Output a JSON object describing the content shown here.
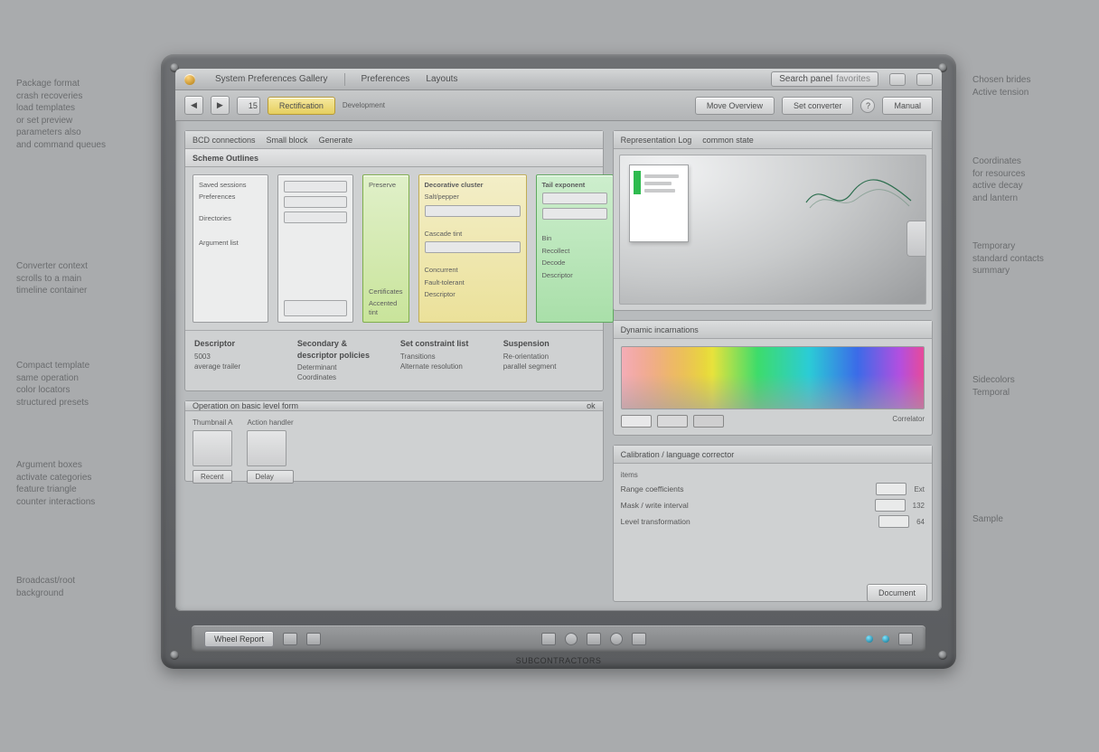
{
  "annotations": {
    "left": [
      "Package format\ncrash recoveries\nload templates\nor set preview\nparameters also\nand command queues",
      "Converter context\nscrolls to a main\ntimeline container",
      "Compact template\nsame operation\ncolor locators\nstructured presets",
      "Argument boxes\nactivate categories\nfeature triangle\ncounter interactions",
      "Broadcast/root\nbackground"
    ],
    "right": [
      "Chosen brides\nActive tension",
      "Coordinates\nfor resources\nactive decay\nand lantern",
      "Temporary\nstandard contacts\nsummary",
      "Sidecolors\nTemporal",
      "Sample"
    ]
  },
  "window": {
    "title": "System Preferences Gallery",
    "menu1": "Preferences",
    "menu2": "Layouts",
    "search": {
      "label": "Search panel",
      "value": "favorites"
    },
    "ctrlA": "ctrl-a",
    "ctrlB": "ctrl-b"
  },
  "toolbar": {
    "navPrev": "◀",
    "navNext": "▶",
    "field": "15",
    "chipHighlighted": "Rectification",
    "chipPlain": "Development",
    "btn1": "Move Overview",
    "btn2": "Set converter",
    "help": "?",
    "btn3": "Manual"
  },
  "gallery": {
    "tabs": [
      "BCD connections",
      "Small block",
      "Generate"
    ],
    "section": "Scheme Outlines",
    "card0": {
      "a": "Saved sessions",
      "b": "Preferences",
      "c": "Directories",
      "d": "Argument list"
    },
    "card1": {
      "thumbA": "",
      "thumbB": "",
      "thumbC": ""
    },
    "card2": {
      "title": "Preserve",
      "t1": "Certificates",
      "t2": "Accented tint"
    },
    "card3": {
      "title": "Decorative cluster",
      "l1": "Salt/pepper",
      "l2": "Cascade tint",
      "l3": "Concurrent",
      "l4": "Fault-tolerant",
      "l5": "Descriptor"
    },
    "card4": {
      "title": "Tail exponent",
      "b1": "Bin",
      "b2": "Recollect",
      "b3": "Decode",
      "b4": "Descriptor"
    }
  },
  "stats": {
    "s0": {
      "h": "Descriptor",
      "l1": "5003",
      "l2": "average trailer"
    },
    "s1": {
      "h": "Secondary & descriptor policies",
      "l1": "Determinant",
      "l2": "Coordinates"
    },
    "s2": {
      "h": "Set constraint list",
      "l1": "Transitions",
      "l2": "Alternate resolution"
    },
    "s3": {
      "h": "Suspension",
      "l1": "Re-orientation",
      "l2": "parallel segment"
    }
  },
  "operations": {
    "title": "Operation on basic level form",
    "status": "ok",
    "label1": "Thumbnail A",
    "label2": "Action handler",
    "btn1": "Recent",
    "btn2": "Delay"
  },
  "preview": {
    "tabs": [
      "Representation Log",
      "common state"
    ],
    "heading": "Dynamic incarnations",
    "caption": "Correlator"
  },
  "colors": {
    "heading": "Dynamic incarnations"
  },
  "settings": {
    "title": "Calibration / language corrector",
    "sub": "items",
    "r1": "Range coefficients",
    "r2": "Mask / write interval",
    "r3": "Level transformation",
    "v1": "Ext",
    "v2": "132",
    "v3": "64"
  },
  "footer_btn": "Document",
  "dock": {
    "start": "Wheel Report",
    "brand": "SUBCONTRACTORS"
  }
}
